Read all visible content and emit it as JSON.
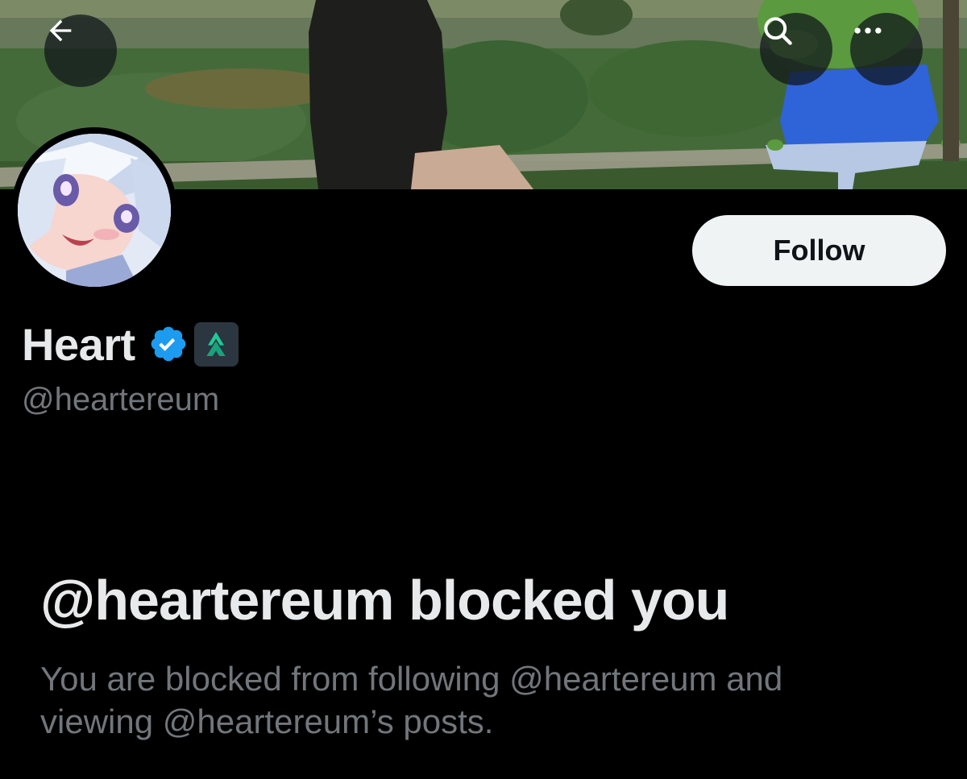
{
  "header": {
    "back_icon": "arrow-left-icon",
    "search_icon": "search-icon",
    "more_icon": "more-horizontal-icon"
  },
  "profile": {
    "display_name": "Heart",
    "handle": "@heartereum",
    "verified_badge": "verified-badge-icon",
    "affiliation_badge": "affiliation-badge-icon",
    "follow_label": "Follow"
  },
  "blocked": {
    "title": "@heartereum blocked you",
    "description": "You are blocked from following @heartereum and viewing @heartereum’s posts."
  },
  "colors": {
    "background": "#000000",
    "primary_text": "#e7e9ea",
    "secondary_text": "#71767b",
    "verified_blue": "#1d9bf0",
    "follow_button_bg": "#eff3f4",
    "affiliation_green": "#20c997"
  }
}
